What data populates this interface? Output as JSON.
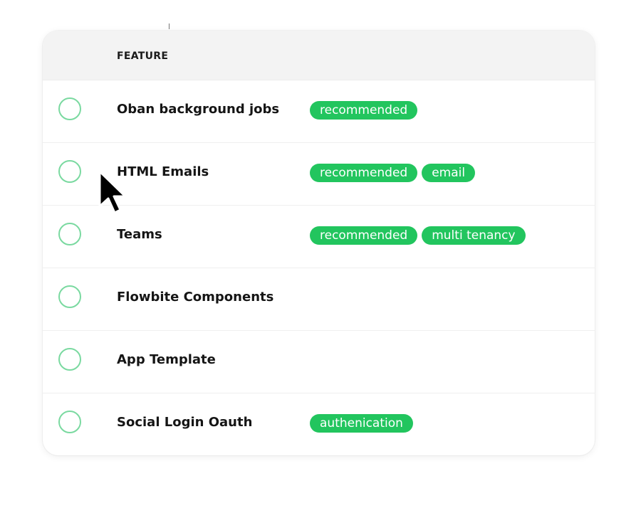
{
  "header": {
    "feature_label": "FEATURE"
  },
  "colors": {
    "tag_background": "#22c55e",
    "check_border": "#7ad9a0",
    "header_background": "#f3f3f3"
  },
  "rows": [
    {
      "name": "Oban background jobs",
      "checked": false,
      "tags": [
        "recommended"
      ]
    },
    {
      "name": "HTML Emails",
      "checked": false,
      "tags": [
        "recommended",
        "email"
      ]
    },
    {
      "name": "Teams",
      "checked": false,
      "tags": [
        "recommended",
        "multi tenancy"
      ]
    },
    {
      "name": "Flowbite Components",
      "checked": false,
      "tags": []
    },
    {
      "name": "App Template",
      "checked": false,
      "tags": []
    },
    {
      "name": "Social Login Oauth",
      "checked": false,
      "tags": [
        "authenication"
      ]
    }
  ],
  "cursor": {
    "icon": "arrow-pointer-icon"
  }
}
